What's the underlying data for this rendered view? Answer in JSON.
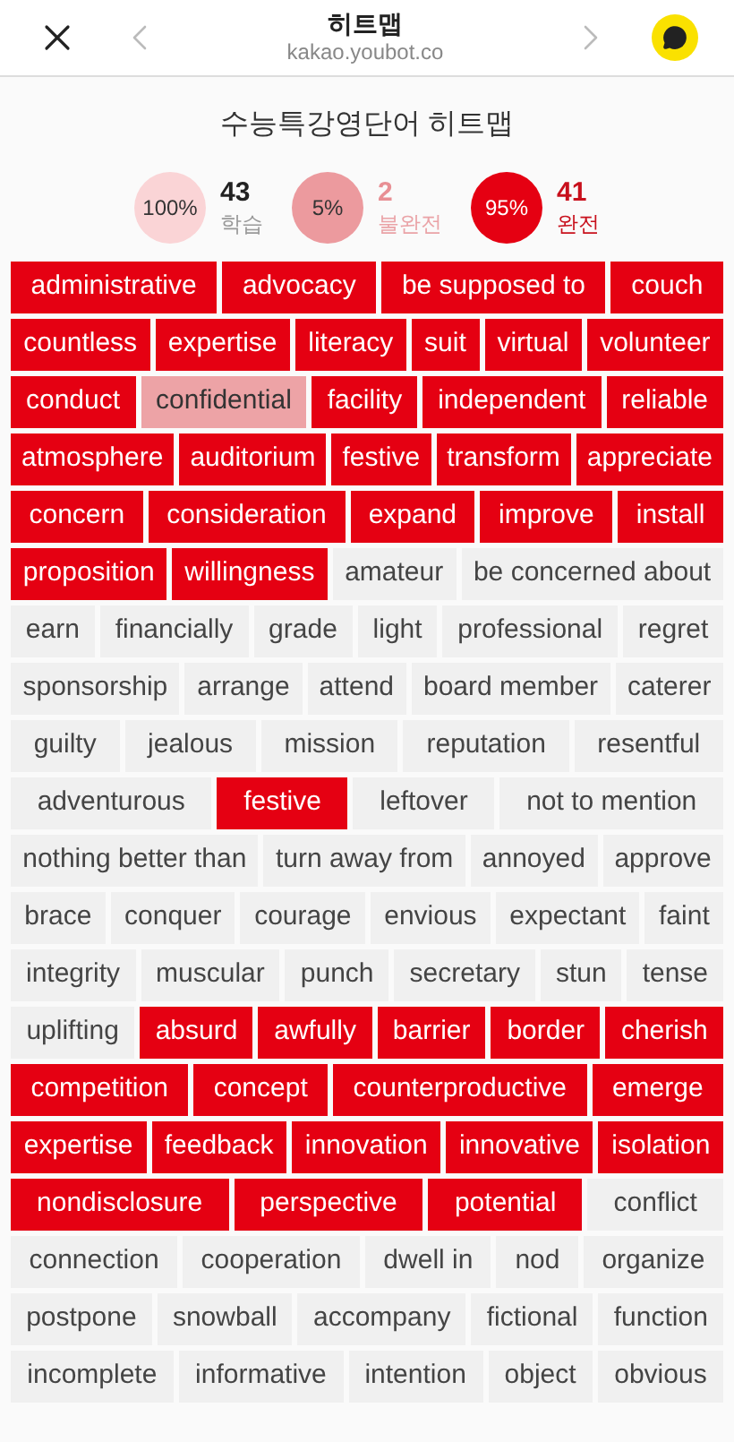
{
  "header": {
    "title": "히트맵",
    "url": "kakao.youbot.co"
  },
  "page_title": "수능특강영단어 히트맵",
  "stats": [
    {
      "percent": "100%",
      "count": "43",
      "label": "학습",
      "color": "#fad4d6"
    },
    {
      "percent": "5%",
      "count": "2",
      "label": "불완전",
      "color": "#ec9a9e"
    },
    {
      "percent": "95%",
      "count": "41",
      "label": "완전",
      "color": "#e50012"
    }
  ],
  "rows": [
    [
      {
        "word": "administrative",
        "kind": "done"
      },
      {
        "word": "advocacy",
        "kind": "done"
      },
      {
        "word": "be supposed to",
        "kind": "done"
      },
      {
        "word": "couch",
        "kind": "done"
      }
    ],
    [
      {
        "word": "countless",
        "kind": "done"
      },
      {
        "word": "expertise",
        "kind": "done"
      },
      {
        "word": "literacy",
        "kind": "done"
      },
      {
        "word": "suit",
        "kind": "done"
      },
      {
        "word": "virtual",
        "kind": "done"
      },
      {
        "word": "volunteer",
        "kind": "done"
      }
    ],
    [
      {
        "word": "conduct",
        "kind": "done"
      },
      {
        "word": "confidential",
        "kind": "partial"
      },
      {
        "word": "facility",
        "kind": "done"
      },
      {
        "word": "independent",
        "kind": "done"
      },
      {
        "word": "reliable",
        "kind": "done"
      }
    ],
    [
      {
        "word": "atmosphere",
        "kind": "done"
      },
      {
        "word": "auditorium",
        "kind": "done"
      },
      {
        "word": "festive",
        "kind": "done"
      },
      {
        "word": "transform",
        "kind": "done"
      },
      {
        "word": "appreciate",
        "kind": "done"
      }
    ],
    [
      {
        "word": "concern",
        "kind": "done"
      },
      {
        "word": "consideration",
        "kind": "done"
      },
      {
        "word": "expand",
        "kind": "done"
      },
      {
        "word": "improve",
        "kind": "done"
      },
      {
        "word": "install",
        "kind": "done"
      }
    ],
    [
      {
        "word": "proposition",
        "kind": "done"
      },
      {
        "word": "willingness",
        "kind": "done"
      },
      {
        "word": "amateur",
        "kind": "new"
      },
      {
        "word": "be concerned about",
        "kind": "new"
      }
    ],
    [
      {
        "word": "earn",
        "kind": "new"
      },
      {
        "word": "financially",
        "kind": "new"
      },
      {
        "word": "grade",
        "kind": "new"
      },
      {
        "word": "light",
        "kind": "new"
      },
      {
        "word": "professional",
        "kind": "new"
      },
      {
        "word": "regret",
        "kind": "new"
      }
    ],
    [
      {
        "word": "sponsorship",
        "kind": "new"
      },
      {
        "word": "arrange",
        "kind": "new"
      },
      {
        "word": "attend",
        "kind": "new"
      },
      {
        "word": "board member",
        "kind": "new"
      },
      {
        "word": "caterer",
        "kind": "new"
      }
    ],
    [
      {
        "word": "guilty",
        "kind": "new"
      },
      {
        "word": "jealous",
        "kind": "new"
      },
      {
        "word": "mission",
        "kind": "new"
      },
      {
        "word": "reputation",
        "kind": "new"
      },
      {
        "word": "resentful",
        "kind": "new"
      }
    ],
    [
      {
        "word": "adventurous",
        "kind": "new"
      },
      {
        "word": "festive",
        "kind": "done"
      },
      {
        "word": "leftover",
        "kind": "new"
      },
      {
        "word": "not to mention",
        "kind": "new"
      }
    ],
    [
      {
        "word": "nothing better than",
        "kind": "new"
      },
      {
        "word": "turn away from",
        "kind": "new"
      },
      {
        "word": "annoyed",
        "kind": "new"
      },
      {
        "word": "approve",
        "kind": "new"
      }
    ],
    [
      {
        "word": "brace",
        "kind": "new"
      },
      {
        "word": "conquer",
        "kind": "new"
      },
      {
        "word": "courage",
        "kind": "new"
      },
      {
        "word": "envious",
        "kind": "new"
      },
      {
        "word": "expectant",
        "kind": "new"
      },
      {
        "word": "faint",
        "kind": "new"
      }
    ],
    [
      {
        "word": "integrity",
        "kind": "new"
      },
      {
        "word": "muscular",
        "kind": "new"
      },
      {
        "word": "punch",
        "kind": "new"
      },
      {
        "word": "secretary",
        "kind": "new"
      },
      {
        "word": "stun",
        "kind": "new"
      },
      {
        "word": "tense",
        "kind": "new"
      }
    ],
    [
      {
        "word": "uplifting",
        "kind": "new"
      },
      {
        "word": "absurd",
        "kind": "done"
      },
      {
        "word": "awfully",
        "kind": "done"
      },
      {
        "word": "barrier",
        "kind": "done"
      },
      {
        "word": "border",
        "kind": "done"
      },
      {
        "word": "cherish",
        "kind": "done"
      }
    ],
    [
      {
        "word": "competition",
        "kind": "done"
      },
      {
        "word": "concept",
        "kind": "done"
      },
      {
        "word": "counterproductive",
        "kind": "done"
      },
      {
        "word": "emerge",
        "kind": "done"
      }
    ],
    [
      {
        "word": "expertise",
        "kind": "done"
      },
      {
        "word": "feedback",
        "kind": "done"
      },
      {
        "word": "innovation",
        "kind": "done"
      },
      {
        "word": "innovative",
        "kind": "done"
      },
      {
        "word": "isolation",
        "kind": "done"
      }
    ],
    [
      {
        "word": "nondisclosure",
        "kind": "done"
      },
      {
        "word": "perspective",
        "kind": "done"
      },
      {
        "word": "potential",
        "kind": "done"
      },
      {
        "word": "conflict",
        "kind": "new"
      }
    ],
    [
      {
        "word": "connection",
        "kind": "new"
      },
      {
        "word": "cooperation",
        "kind": "new"
      },
      {
        "word": "dwell in",
        "kind": "new"
      },
      {
        "word": "nod",
        "kind": "new"
      },
      {
        "word": "organize",
        "kind": "new"
      }
    ],
    [
      {
        "word": "postpone",
        "kind": "new"
      },
      {
        "word": "snowball",
        "kind": "new"
      },
      {
        "word": "accompany",
        "kind": "new"
      },
      {
        "word": "fictional",
        "kind": "new"
      },
      {
        "word": "function",
        "kind": "new"
      }
    ],
    [
      {
        "word": "incomplete",
        "kind": "new"
      },
      {
        "word": "informative",
        "kind": "new"
      },
      {
        "word": "intention",
        "kind": "new"
      },
      {
        "word": "object",
        "kind": "new"
      },
      {
        "word": "obvious",
        "kind": "new"
      }
    ]
  ]
}
